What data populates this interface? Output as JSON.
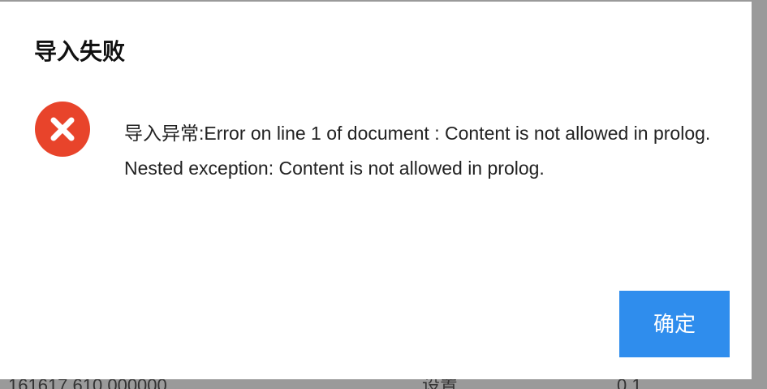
{
  "dialog": {
    "title": "导入失败",
    "icon": "error-circle-x-icon",
    "icon_color": "#e8442b",
    "message": "导入异常:Error on line 1 of document : Content is not allowed in prolog. Nested exception: Content is not allowed in prolog.",
    "confirm_label": "确定",
    "accent_color": "#2f8ded"
  }
}
